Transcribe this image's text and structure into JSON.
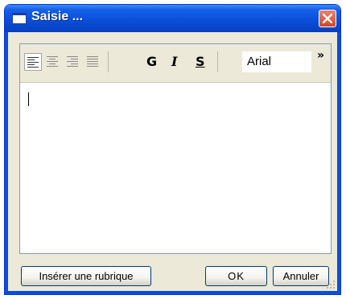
{
  "window": {
    "title": "Saisie ..."
  },
  "toolbar": {
    "bold_label": "G",
    "italic_label": "I",
    "strike_label": "S",
    "font_name": "Arial",
    "more_label": "»"
  },
  "icons": [
    "window-icon",
    "close-icon",
    "align-left-icon",
    "align-center-icon",
    "align-right-icon",
    "justify-icon",
    "chevron-more-icon",
    "resize-grip-icon"
  ],
  "editor": {
    "text": ""
  },
  "footer": {
    "insert_button": "Insérer une rubrique",
    "ok_button": "OK",
    "cancel_button": "Annuler"
  },
  "colors": {
    "title_bar": "#0a4fd9",
    "close": "#d0452a",
    "face": "#ece9d8"
  }
}
